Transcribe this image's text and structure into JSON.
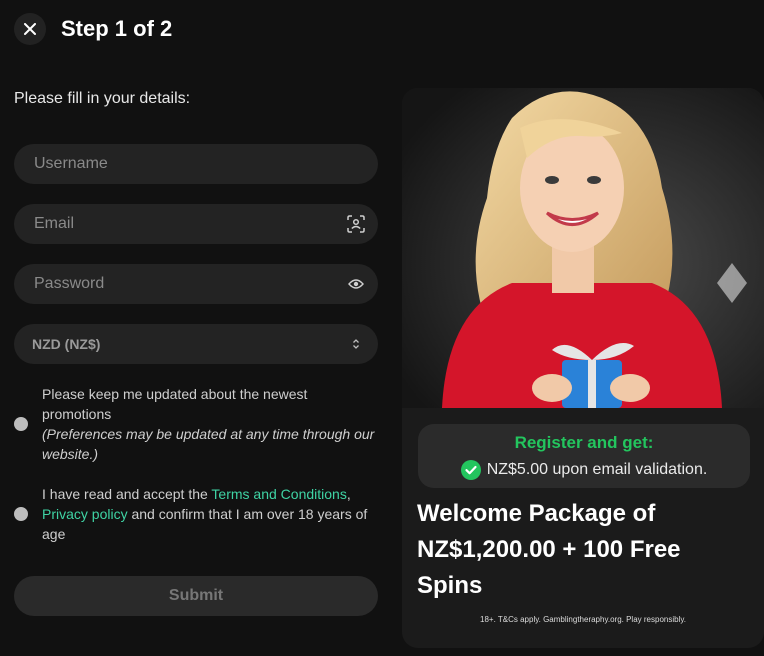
{
  "header": {
    "close_icon": "close-icon",
    "title": "Step 1 of 2"
  },
  "form": {
    "intro": "Please fill in your details:",
    "username": {
      "placeholder": "Username",
      "value": ""
    },
    "email": {
      "placeholder": "Email",
      "value": "",
      "icon": "id-scan-icon"
    },
    "password": {
      "placeholder": "Password",
      "value": "",
      "icon": "eye-icon"
    },
    "currency": {
      "selected": "NZD (NZ$)",
      "icon": "sort-arrows-icon"
    },
    "updates_consent": {
      "text": "Please keep me updated about the newest promotions",
      "note": "(Preferences may be updated at any time through our website.)"
    },
    "terms_consent": {
      "prefix": "I have read and accept the ",
      "terms_link": "Terms and Conditions",
      "comma": ",",
      "privacy_link": "Privacy policy",
      "suffix": " and confirm that I am over 18 years of age"
    },
    "submit_label": "Submit"
  },
  "promo": {
    "register_title": "Register and get:",
    "register_bonus": "NZ$5.00 upon email validation.",
    "headline": "Welcome Package of NZ$1,200.00 + 100 Free Spins",
    "disclaimer": "18+. T&Cs apply. Gamblingtheraphy.org. Play responsibly.",
    "colors": {
      "accent_green": "#23c55e",
      "link_teal": "#3fd3a4"
    }
  }
}
